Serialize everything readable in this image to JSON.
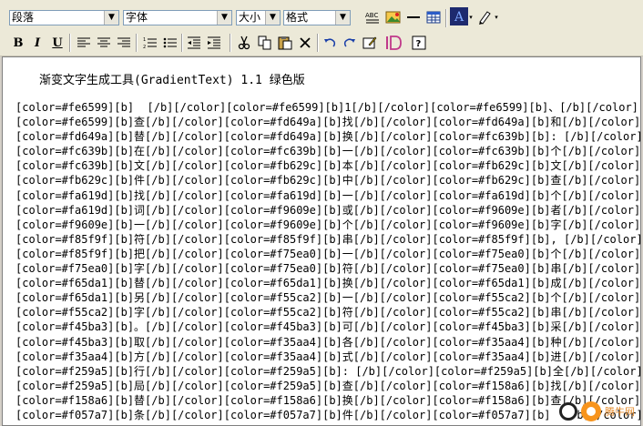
{
  "toolbar": {
    "paragraph_select": "段落",
    "font_select": "字体",
    "size_select": "大小",
    "format_select": "格式",
    "bold": "B",
    "italic": "I",
    "underline": "U"
  },
  "editor": {
    "title": "渐变文字生成工具(GradientText) 1.1 绿色版",
    "lines": [
      "[color=#fe6599][b]  [/b][/color][color=#fe6599][b]1[/b][/color][color=#fe6599][b]、[/b][/color]",
      "[color=#fe6599][b]查[/b][/color][color=#fd649a][b]找[/b][/color][color=#fd649a][b]和[/b][/color]",
      "[color=#fd649a][b]替[/b][/color][color=#fd649a][b]换[/b][/color][color=#fc639b][b]: [/b][/color]",
      "[color=#fc639b][b]在[/b][/color][color=#fc639b][b]一[/b][/color][color=#fc639b][b]个[/b][/color]",
      "[color=#fc639b][b]文[/b][/color][color=#fb629c][b]本[/b][/color][color=#fb629c][b]文[/b][/color]",
      "[color=#fb629c][b]件[/b][/color][color=#fb629c][b]中[/b][/color][color=#fb629c][b]查[/b][/color]",
      "[color=#fa619d][b]找[/b][/color][color=#fa619d][b]一[/b][/color][color=#fa619d][b]个[/b][/color]",
      "[color=#fa619d][b]词[/b][/color][color=#f9609e][b]或[/b][/color][color=#f9609e][b]者[/b][/color]",
      "[color=#f9609e][b]一[/b][/color][color=#f9609e][b]个[/b][/color][color=#f9609e][b]字[/b][/color]",
      "[color=#f85f9f][b]符[/b][/color][color=#f85f9f][b]串[/b][/color][color=#f85f9f][b], [/b][/color]",
      "[color=#f85f9f][b]把[/b][/color][color=#f75ea0][b]一[/b][/color][color=#f75ea0][b]个[/b][/color]",
      "[color=#f75ea0][b]字[/b][/color][color=#f75ea0][b]符[/b][/color][color=#f75ea0][b]串[/b][/color]",
      "[color=#f65da1][b]替[/b][/color][color=#f65da1][b]换[/b][/color][color=#f65da1][b]成[/b][/color]",
      "[color=#f65da1][b]另[/b][/color][color=#f55ca2][b]一[/b][/color][color=#f55ca2][b]个[/b][/color]",
      "[color=#f55ca2][b]字[/b][/color][color=#f55ca2][b]符[/b][/color][color=#f55ca2][b]串[/b][/color]",
      "[color=#f45ba3][b]。[/b][/color][color=#f45ba3][b]可[/b][/color][color=#f45ba3][b]采[/b][/color]",
      "[color=#f45ba3][b]取[/b][/color][color=#f35aa4][b]各[/b][/color][color=#f35aa4][b]种[/b][/color]",
      "[color=#f35aa4][b]方[/b][/color][color=#f35aa4][b]式[/b][/color][color=#f35aa4][b]进[/b][/color]",
      "[color=#f259a5][b]行[/b][/color][color=#f259a5][b]: [/b][/color][color=#f259a5][b]全[/b][/color]",
      "[color=#f259a5][b]局[/b][/color][color=#f259a5][b]查[/b][/color][color=#f158a6][b]找[/b][/color]",
      "[color=#f158a6][b]替[/b][/color][color=#f158a6][b]换[/b][/color][color=#f158a6][b]查[/b][/color]",
      "[color=#f057a7][b]条[/b][/color][color=#f057a7][b]件[/b][/color][color=#f057a7][b]  [/b][/color]"
    ]
  },
  "watermark": {
    "text": "腾牛网"
  }
}
